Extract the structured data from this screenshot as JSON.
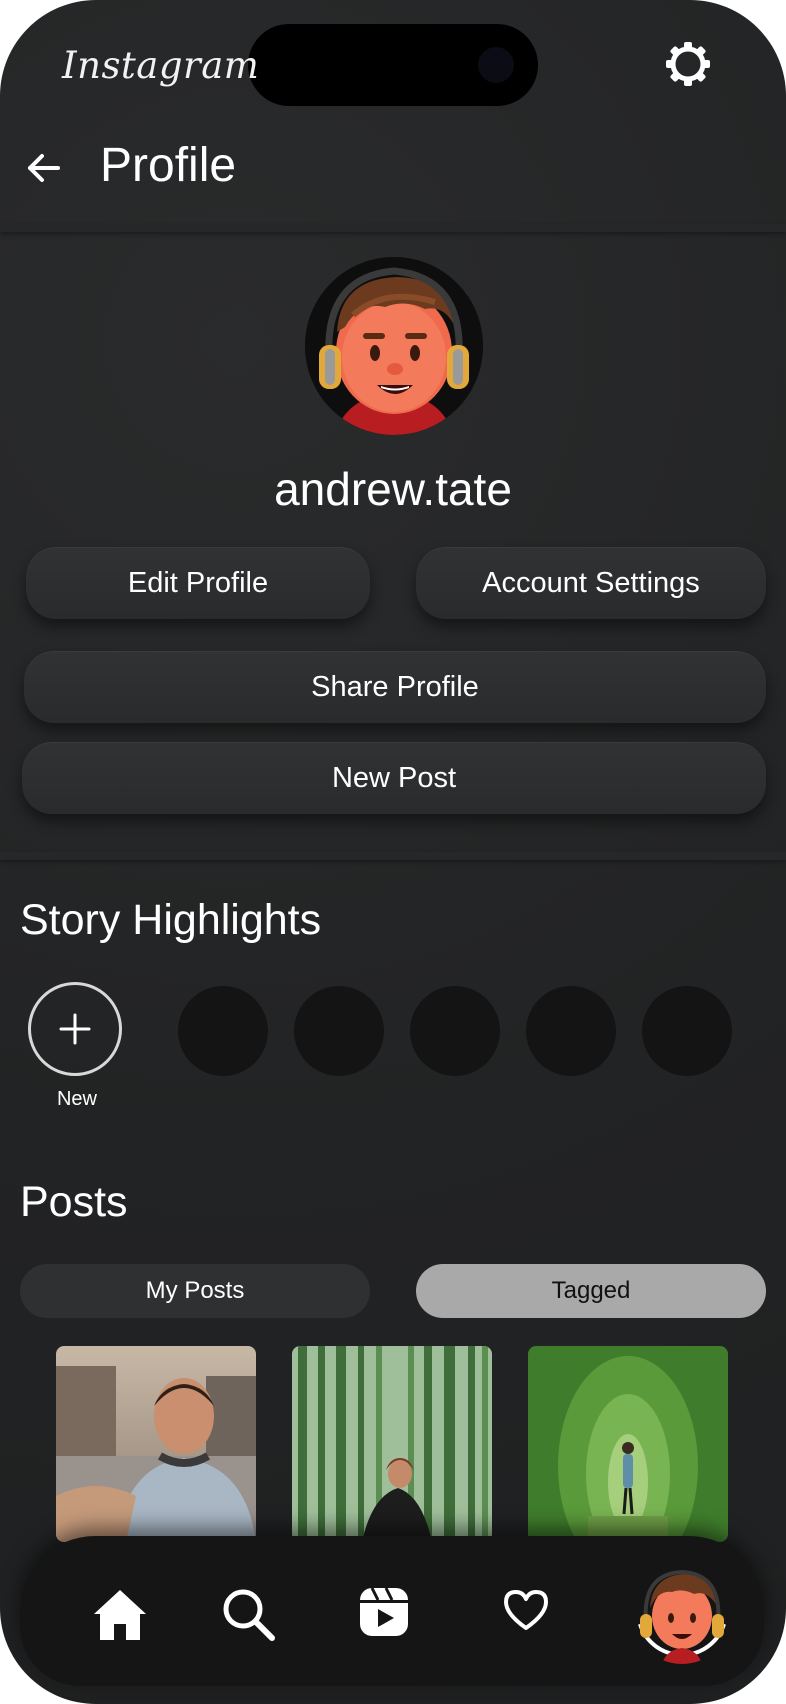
{
  "app": {
    "logo_text": "Instagram",
    "page_title": "Profile"
  },
  "profile": {
    "username": "andrew.tate"
  },
  "buttons": {
    "edit_profile": "Edit Profile",
    "account_settings": "Account Settings",
    "share_profile": "Share Profile",
    "new_post": "New Post"
  },
  "highlights": {
    "title": "Story Highlights",
    "new_label": "New",
    "items": [
      "",
      "",
      "",
      "",
      ""
    ]
  },
  "posts": {
    "title": "Posts",
    "tabs": [
      {
        "label": "My Posts",
        "active": false
      },
      {
        "label": "Tagged",
        "active": true
      }
    ],
    "items": [
      {
        "name": "selfie-photo"
      },
      {
        "name": "bamboo-forest-photo"
      },
      {
        "name": "green-tunnel-photo"
      }
    ]
  },
  "nav": {
    "items": [
      "home-icon",
      "search-icon",
      "reels-icon",
      "heart-icon",
      "profile-avatar"
    ]
  },
  "colors": {
    "background": "#232425",
    "button": "#2e2f30",
    "active_tab": "#a9a9a9",
    "nav_bar": "#151516"
  }
}
